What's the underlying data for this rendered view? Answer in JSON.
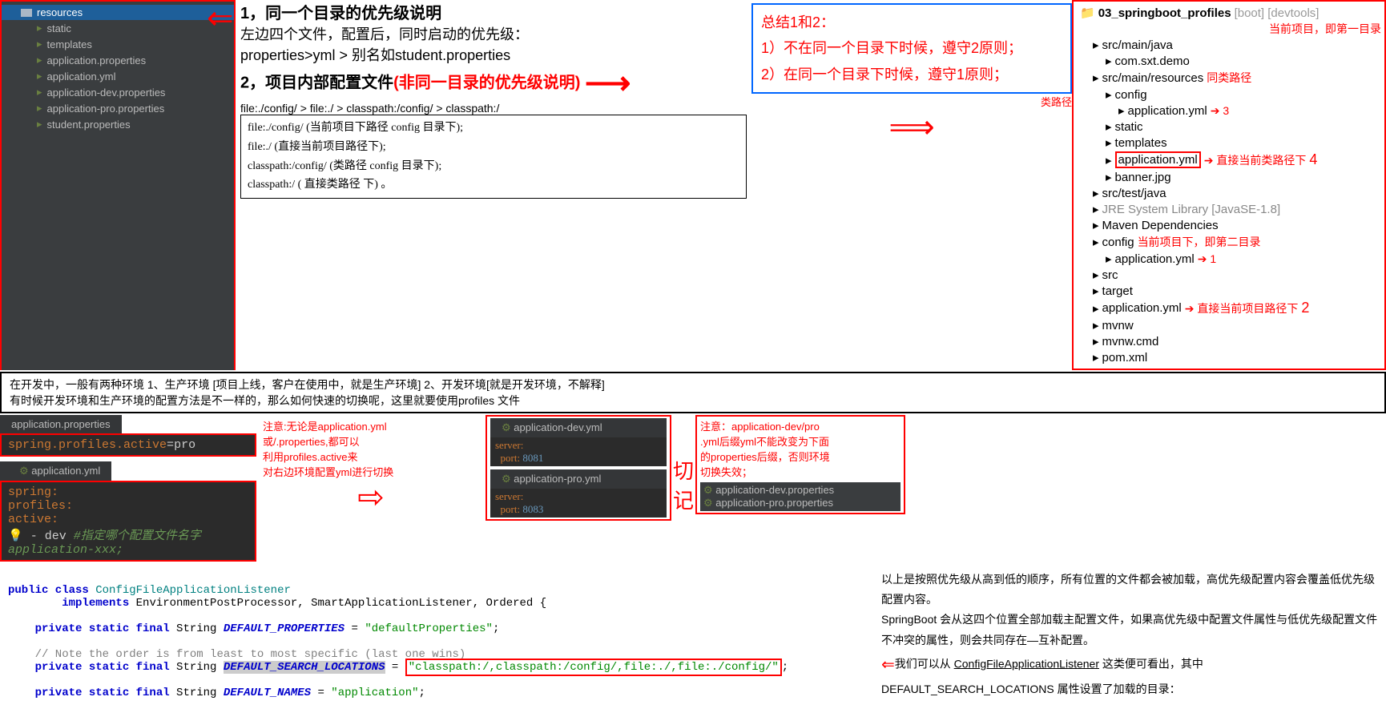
{
  "tree_left": {
    "root": "resources",
    "items": [
      "static",
      "templates",
      "application.properties",
      "application.yml",
      "application-dev.properties",
      "application-pro.properties",
      "student.properties"
    ]
  },
  "section1": {
    "title": "1，同一个目录的优先级说明",
    "line1": "左边四个文件，配置后，同时启动的优先级：",
    "line2": "properties>yml > 别名如student.properties",
    "title2": "2，项目内部配置文件",
    "title2_red": "(非同一目录的优先级说明)",
    "order": "file:./config/  > file:./  > classpath:/config/  > classpath:/",
    "box_lines": [
      "file:./config/ (当前项目下路径 config 目录下);",
      "file:./ (直接当前项目路径下);",
      "classpath:/config/ (类路径 config 目录下);",
      "classpath:/ ( 直接类路径 下) 。"
    ]
  },
  "summary": {
    "head": "总结1和2：",
    "l1": "1）不在同一个目录下时候，遵守2原则；",
    "l2": "2）在同一个目录下时候，遵守1原则；",
    "side": "类路径"
  },
  "gray": {
    "l1": "在开发中，一般有两种环境  1、生产环境  [项目上线，客户在使用中，就是生产环境]  2、开发环境[就是开发环境，不解释]",
    "l2": "有时候开发环境和生产环境的配置方法是不一样的，那么如何快速的切换呢，这里就要使用profiles 文件"
  },
  "ide1": {
    "tab": "application.properties",
    "code": "spring.profiles.active=pro",
    "tab2": "application.yml",
    "yml_l1": "spring:",
    "yml_l2": "  profiles:",
    "yml_l3": "    active:",
    "yml_l4": "    - dev ",
    "yml_cmt": "#指定哪个配置文件名字    application-xxx;"
  },
  "note1": {
    "l1": "注意:无论是application.yml",
    "l2": "或/.properties,都可以",
    "l3": "利用profiles.active来",
    "l4": "对右边环境配置yml进行切换"
  },
  "dev_box": {
    "tab": "application-dev.yml",
    "l1": "server:",
    "l2": "  port: 8081"
  },
  "pro_box": {
    "tab": "application-pro.yml",
    "l1": "server:",
    "l2": "  port: 8083"
  },
  "qieji": "切记",
  "note2": {
    "l1": "注意：application-dev/pro",
    "l2": ".yml后缀yml不能改变为下面",
    "l3": "的properties后缀，否则环境",
    "l4": "切换失效；"
  },
  "bad_props": [
    "application-dev.properties",
    "application-pro.properties"
  ],
  "right_tree": {
    "root": "03_springboot_profiles",
    "root_suffix": " [boot] [devtools]",
    "ann_root": "当前项目，即第一目录",
    "items": [
      {
        "t": "src/main/java",
        "pad": 20
      },
      {
        "t": "com.sxt.demo",
        "pad": 36
      },
      {
        "t": "src/main/resources",
        "pad": 20,
        "ann": "同类路径"
      },
      {
        "t": "config",
        "pad": 36
      },
      {
        "t": "application.yml",
        "pad": 52,
        "ann": "3",
        "arrow": true
      },
      {
        "t": "static",
        "pad": 36
      },
      {
        "t": "templates",
        "pad": 36
      },
      {
        "t": "application.yml",
        "pad": 36,
        "ann": "直接当前类路径下",
        "arrow": true,
        "box": true,
        "num": "4"
      },
      {
        "t": "banner.jpg",
        "pad": 36
      },
      {
        "t": "src/test/java",
        "pad": 20
      },
      {
        "t": "JRE System Library [JavaSE-1.8]",
        "pad": 20,
        "gray": true
      },
      {
        "t": "Maven Dependencies",
        "pad": 20
      },
      {
        "t": "config",
        "pad": 20,
        "ann": "当前项目下，即第二目录"
      },
      {
        "t": "application.yml",
        "pad": 36,
        "ann": "1",
        "arrow": true
      },
      {
        "t": "src",
        "pad": 20
      },
      {
        "t": "target",
        "pad": 20
      },
      {
        "t": "application.yml",
        "pad": 20,
        "ann": "直接当前项目路径下",
        "arrow": true,
        "num": "2"
      },
      {
        "t": "mvnw",
        "pad": 20
      },
      {
        "t": "mvnw.cmd",
        "pad": 20
      },
      {
        "t": "pom.xml",
        "pad": 20
      }
    ]
  },
  "java": {
    "l1a": "public class ",
    "l1b": "ConfigFileApplicationListener",
    "l2a": "        implements ",
    "l2b": "EnvironmentPostProcessor, SmartApplicationListener, Ordered {",
    "l3a": "    private static final ",
    "l3b": "String ",
    "l3c": "DEFAULT_PROPERTIES",
    "l3d": " = ",
    "l3e": "\"defaultProperties\"",
    "cmt": "    // Note the order is from least to most specific (last one wins)",
    "l4a": "    private static final ",
    "l4b": "String ",
    "l4c": "DEFAULT_SEARCH_LOCATIONS",
    "l4d": " = ",
    "l4e": "\"classpath:/,classpath:/config/,file:./,file:./config/\"",
    "l5a": "    private static final ",
    "l5b": "String ",
    "l5c": "DEFAULT_NAMES",
    "l5d": " = ",
    "l5e": "\"application\""
  },
  "bottom": {
    "p1": "以上是按照优先级从高到低的顺序，所有位置的文件都会被加载，高优先级配置内容会覆盖低优先级配置内容。",
    "p2": "SpringBoot 会从这四个位置全部加载主配置文件，如果高优先级中配置文件属性与低优先级配置文件不冲突的属性，则会共同存在—互补配置。",
    "p3a": "我们可以从 ",
    "p3b": "ConfigFileApplicationListener",
    "p3c": " 这类便可看出，其中 DEFAULT_SEARCH_LOCATIONS 属性设置了加载的目录："
  }
}
